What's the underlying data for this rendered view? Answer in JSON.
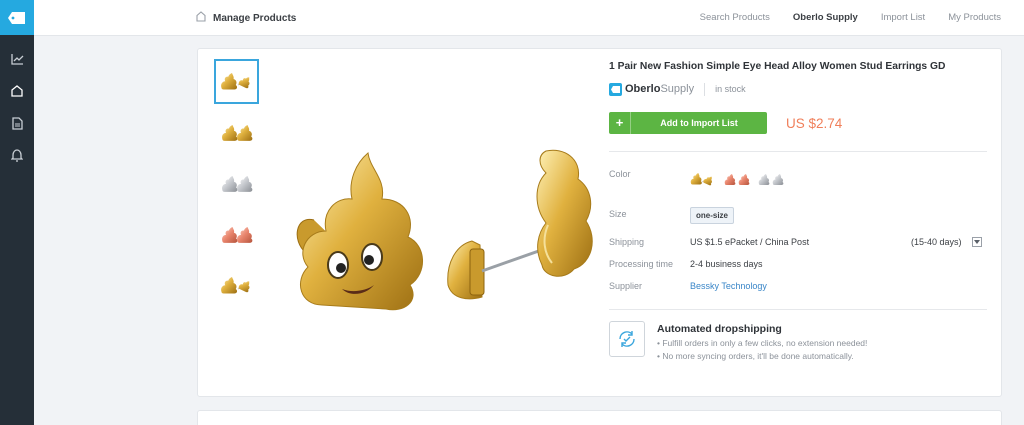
{
  "header": {
    "breadcrumb": "Manage Products",
    "links": [
      {
        "label": "Search Products",
        "active": false
      },
      {
        "label": "Oberlo Supply",
        "active": true
      },
      {
        "label": "Import List",
        "active": false
      },
      {
        "label": "My Products",
        "active": false
      }
    ]
  },
  "sidebar": {
    "icons": [
      "tag-icon",
      "chart-icon",
      "home-icon",
      "document-icon",
      "bell-icon"
    ]
  },
  "product": {
    "title": "1 Pair New Fashion Simple Eye Head Alloy Women Stud Earrings GD",
    "brand_strong": "Oberlo",
    "brand_light": "Supply",
    "stock": "in stock",
    "add_button": "Add to Import List",
    "price": "US $2.74",
    "thumbnail_variants": [
      "gold-pair",
      "gold",
      "silver",
      "rose-gold",
      "gold-pair"
    ],
    "selected_thumbnail": 0,
    "details": {
      "color_label": "Color",
      "color_variants": [
        "gold",
        "rose-gold",
        "silver"
      ],
      "size_label": "Size",
      "size_value": "one-size",
      "shipping_label": "Shipping",
      "shipping_value": "US $1.5 ePacket / China Post",
      "shipping_days": "(15-40 days)",
      "processing_label": "Processing time",
      "processing_value": "2-4 business days",
      "supplier_label": "Supplier",
      "supplier_value": "Bessky Technology"
    },
    "automation": {
      "title": "Automated dropshipping",
      "line1": "• Fulfill orders in only a few clicks, no extension needed!",
      "line2": "• No more syncing orders, it'll be done automatically."
    }
  },
  "colors": {
    "accent_blue": "#25a9e0",
    "sidebar_dark": "#252f38",
    "button_green": "#5cb543",
    "price_orange": "#f07f5a",
    "link_blue": "#3a86c8",
    "gold": "#d9a83a",
    "rose_gold": "#e8846c",
    "silver": "#c4c7cc"
  }
}
